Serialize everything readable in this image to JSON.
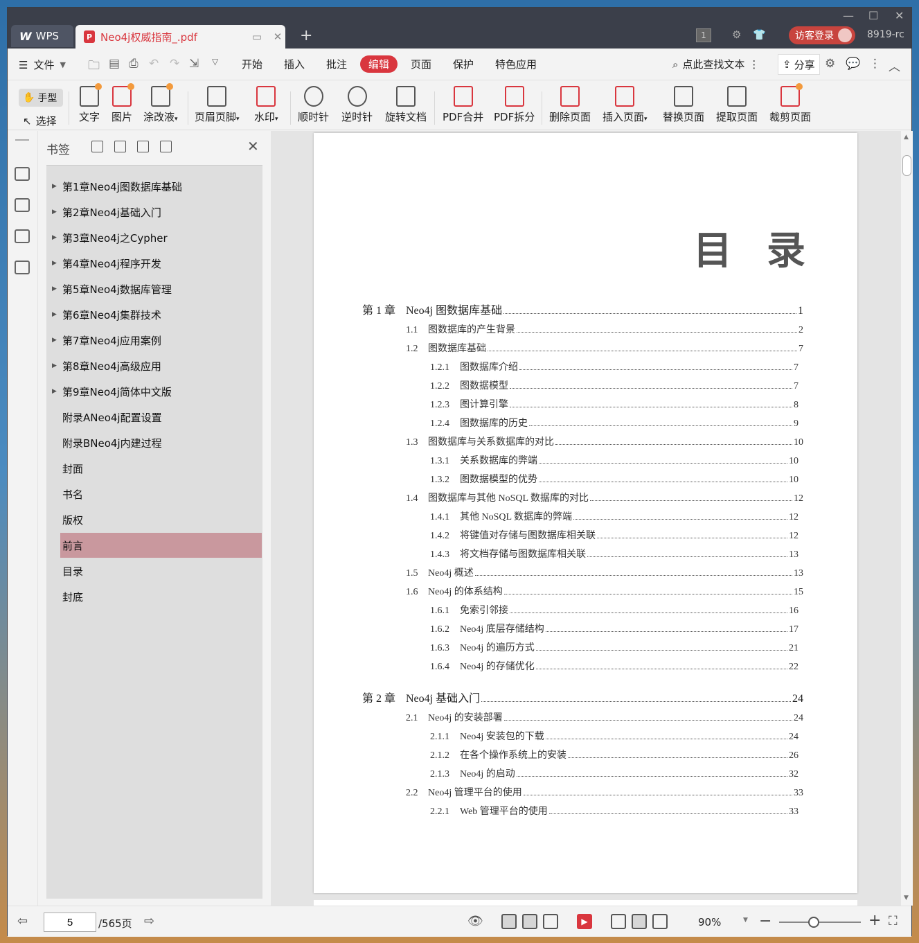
{
  "titlebar": {
    "app_label": "WPS",
    "doc_tab": "Neo4j权威指南_.pdf",
    "badge": "1",
    "login": "访客登录",
    "user_id": "8919-rc"
  },
  "menubar": {
    "file": "文件",
    "tabs": [
      "开始",
      "插入",
      "批注",
      "编辑",
      "页面",
      "保护",
      "特色应用"
    ],
    "active_tab": "编辑",
    "search": "点此查找文本",
    "share": "分享"
  },
  "toolbar": {
    "hand": "手型",
    "select": "选择",
    "tools": [
      "文字",
      "图片",
      "涂改液",
      "页眉页脚",
      "水印",
      "顺时针",
      "逆时针",
      "旋转文档",
      "PDF合并",
      "PDF拆分",
      "删除页面",
      "插入页面",
      "替换页面",
      "提取页面",
      "裁剪页面"
    ]
  },
  "bookmarks": {
    "title": "书签",
    "items": [
      {
        "label": "第1章Neo4j图数据库基础",
        "expandable": true
      },
      {
        "label": "第2章Neo4j基础入门",
        "expandable": true
      },
      {
        "label": "第3章Neo4j之Cypher",
        "expandable": true
      },
      {
        "label": "第4章Neo4j程序开发",
        "expandable": true
      },
      {
        "label": "第5章Neo4j数据库管理",
        "expandable": true
      },
      {
        "label": "第6章Neo4j集群技术",
        "expandable": true
      },
      {
        "label": "第7章Neo4j应用案例",
        "expandable": true
      },
      {
        "label": "第8章Neo4j高级应用",
        "expandable": true
      },
      {
        "label": "第9章Neo4j简体中文版",
        "expandable": true
      },
      {
        "label": "附录ANeo4j配置设置",
        "expandable": false
      },
      {
        "label": "附录BNeo4j内建过程",
        "expandable": false
      },
      {
        "label": "封面",
        "expandable": false
      },
      {
        "label": "书名",
        "expandable": false
      },
      {
        "label": "版权",
        "expandable": false
      },
      {
        "label": "前言",
        "expandable": false,
        "selected": true
      },
      {
        "label": "目录",
        "expandable": false
      },
      {
        "label": "封底",
        "expandable": false
      }
    ]
  },
  "document": {
    "toc_title": "目录",
    "entries": [
      {
        "level": "chapter",
        "num": "第 1 章",
        "text": "Neo4j 图数据库基础",
        "page": "1"
      },
      {
        "level": "sec",
        "num": "1.1",
        "text": "图数据库的产生背景",
        "page": "2"
      },
      {
        "level": "sec",
        "num": "1.2",
        "text": "图数据库基础",
        "page": "7"
      },
      {
        "level": "sub",
        "num": "1.2.1",
        "text": "图数据库介绍",
        "page": "7"
      },
      {
        "level": "sub",
        "num": "1.2.2",
        "text": "图数据模型",
        "page": "7"
      },
      {
        "level": "sub",
        "num": "1.2.3",
        "text": "图计算引擎",
        "page": "8"
      },
      {
        "level": "sub",
        "num": "1.2.4",
        "text": "图数据库的历史",
        "page": "9"
      },
      {
        "level": "sec",
        "num": "1.3",
        "text": "图数据库与关系数据库的对比",
        "page": "10"
      },
      {
        "level": "sub",
        "num": "1.3.1",
        "text": "关系数据库的弊端",
        "page": "10"
      },
      {
        "level": "sub",
        "num": "1.3.2",
        "text": "图数据模型的优势",
        "page": "10"
      },
      {
        "level": "sec",
        "num": "1.4",
        "text": "图数据库与其他 NoSQL 数据库的对比",
        "page": "12"
      },
      {
        "level": "sub",
        "num": "1.4.1",
        "text": "其他 NoSQL 数据库的弊端",
        "page": "12"
      },
      {
        "level": "sub",
        "num": "1.4.2",
        "text": "将键值对存储与图数据库相关联",
        "page": "12"
      },
      {
        "level": "sub",
        "num": "1.4.3",
        "text": "将文档存储与图数据库相关联",
        "page": "13"
      },
      {
        "level": "sec",
        "num": "1.5",
        "text": "Neo4j 概述",
        "page": "13"
      },
      {
        "level": "sec",
        "num": "1.6",
        "text": "Neo4j 的体系结构",
        "page": "15"
      },
      {
        "level": "sub",
        "num": "1.6.1",
        "text": "免索引邻接",
        "page": "16"
      },
      {
        "level": "sub",
        "num": "1.6.2",
        "text": "Neo4j 底层存储结构",
        "page": "17"
      },
      {
        "level": "sub",
        "num": "1.6.3",
        "text": "Neo4j 的遍历方式",
        "page": "21"
      },
      {
        "level": "sub",
        "num": "1.6.4",
        "text": "Neo4j 的存储优化",
        "page": "22"
      },
      {
        "level": "chapter",
        "num": "第 2 章",
        "text": "Neo4j 基础入门",
        "page": "24"
      },
      {
        "level": "sec",
        "num": "2.1",
        "text": "Neo4j 的安装部署",
        "page": "24"
      },
      {
        "level": "sub",
        "num": "2.1.1",
        "text": "Neo4j 安装包的下载",
        "page": "24"
      },
      {
        "level": "sub",
        "num": "2.1.2",
        "text": "在各个操作系统上的安装",
        "page": "26"
      },
      {
        "level": "sub",
        "num": "2.1.3",
        "text": "Neo4j 的启动",
        "page": "32"
      },
      {
        "level": "sec",
        "num": "2.2",
        "text": "Neo4j 管理平台的使用",
        "page": "33"
      },
      {
        "level": "sub",
        "num": "2.2.1",
        "text": "Web 管理平台的使用",
        "page": "33"
      }
    ]
  },
  "statusbar": {
    "current_page": "5",
    "total_pages": "/565页",
    "zoom": "90%"
  }
}
